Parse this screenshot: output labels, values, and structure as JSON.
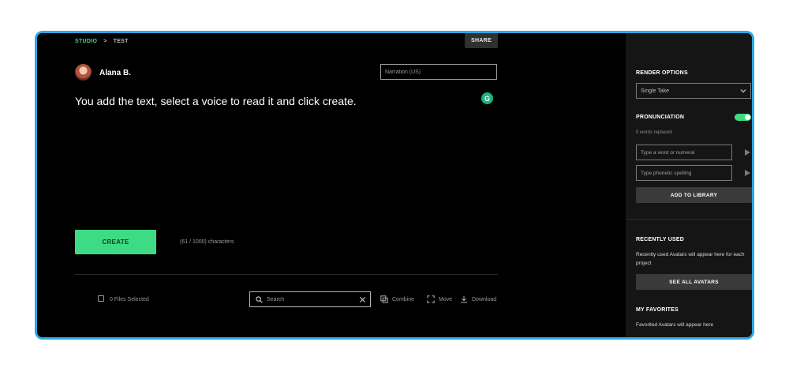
{
  "breadcrumb": {
    "studio": "STUDIO",
    "separator": ">",
    "page": "TEST"
  },
  "header": {
    "share_label": "SHARE"
  },
  "user": {
    "name": "Alana B."
  },
  "voice": {
    "value": "Narration (US)"
  },
  "editor": {
    "script": "You add the text, select a voice to read it and click create.",
    "grammarly": "G"
  },
  "actions": {
    "create_label": "CREATE",
    "char_count": "(61 / 1000) characters"
  },
  "files": {
    "selected_label": "0 Files Selected",
    "search_placeholder": "Search",
    "combine_label": "Combine",
    "move_label": "Move",
    "download_label": "Download"
  },
  "panel": {
    "render_options_title": "RENDER OPTIONS",
    "render_option_selected": "Single Take",
    "pronunciation_title": "PRONUNCIATION",
    "pronunciation_enabled": true,
    "words_replaced": "0 words replaced",
    "word_placeholder": "Type a word or numeral",
    "phonetic_placeholder": "Type phonetic spelling",
    "add_library_label": "ADD TO LIBRARY",
    "recently_used_title": "RECENTLY USED",
    "recently_used_text": "Recently used Avatars will appear here for each project",
    "see_all_label": "SEE ALL AVATARS",
    "favorites_title": "MY FAVORITES",
    "favorites_text": "Favorited Avatars will appear here"
  },
  "colors": {
    "accent": "#3ddc84",
    "frame_border": "#29a8e6",
    "background": "#000000",
    "panel": "#151515"
  }
}
